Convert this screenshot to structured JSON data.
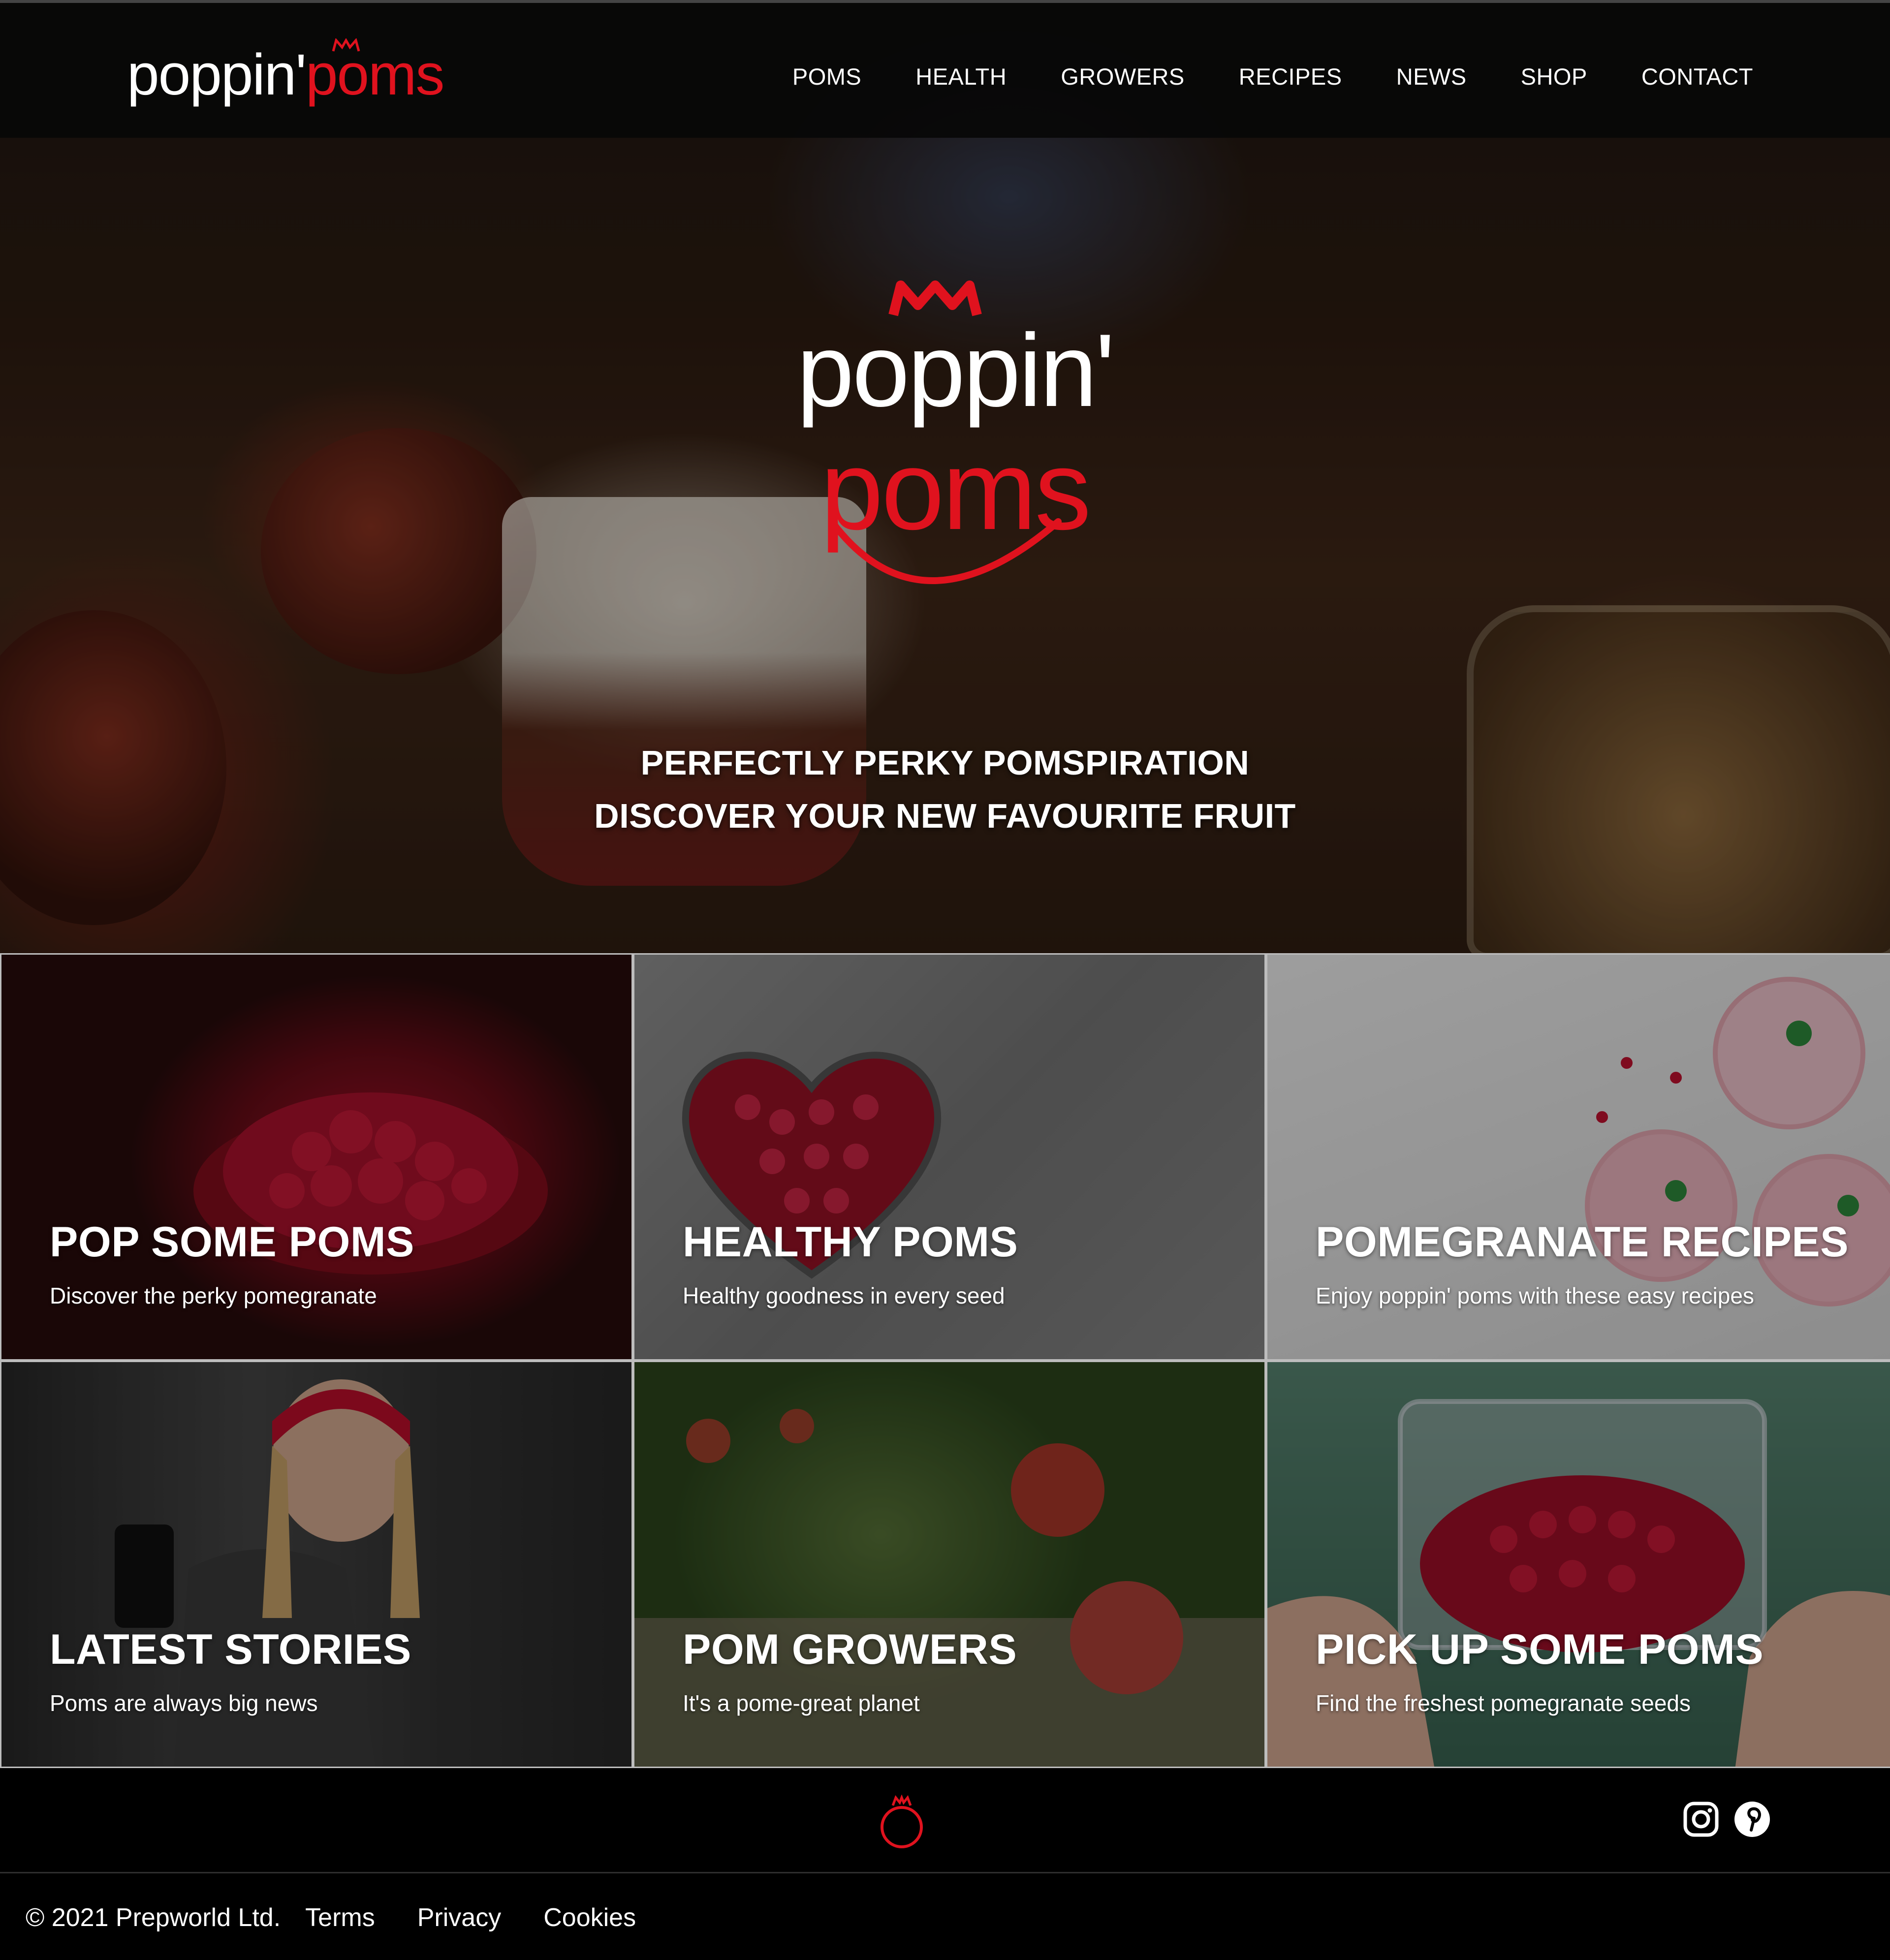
{
  "brand": {
    "name_white": "poppin'",
    "name_red": "poms",
    "accent_color": "#e0121e"
  },
  "nav": {
    "items": [
      "POMS",
      "HEALTH",
      "GROWERS",
      "RECIPES",
      "NEWS",
      "SHOP",
      "CONTACT"
    ]
  },
  "hero": {
    "logo_white": "poppin'",
    "logo_red": "poms",
    "tagline_1": "PERFECTLY PERKY POMSPIRATION",
    "tagline_2": "DISCOVER YOUR NEW FAVOURITE FRUIT"
  },
  "tiles": [
    {
      "title": "POP SOME POMS",
      "subtitle": "Discover the perky pomegranate"
    },
    {
      "title": "HEALTHY POMS",
      "subtitle": "Healthy goodness in every seed"
    },
    {
      "title": "POMEGRANATE RECIPES",
      "subtitle": "Enjoy poppin' poms with these easy recipes"
    },
    {
      "title": "LATEST STORIES",
      "subtitle": "Poms are always big news"
    },
    {
      "title": "POM GROWERS",
      "subtitle": "It's a pome-great planet"
    },
    {
      "title": "PICK UP SOME POMS",
      "subtitle": "Find the freshest pomegranate seeds"
    }
  ],
  "footer": {
    "icons": [
      "pomegranate-icon",
      "instagram-icon",
      "pinterest-icon"
    ],
    "copyright": "© 2021 Prepworld Ltd.",
    "links": [
      "Terms",
      "Privacy",
      "Cookies"
    ]
  }
}
